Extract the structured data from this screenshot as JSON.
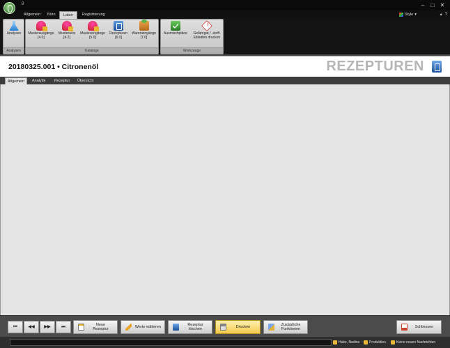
{
  "window": {
    "title": "8",
    "controls": {
      "minimize": "–",
      "maximize": "□",
      "close": "✕"
    }
  },
  "ribbon": {
    "tabs": [
      {
        "label": "Allgemein",
        "active": false
      },
      {
        "label": "Büro",
        "active": false
      },
      {
        "label": "Labor",
        "active": true
      },
      {
        "label": "Registrierung",
        "active": false
      }
    ],
    "style_label": "Style",
    "groups": {
      "analysen": {
        "caption": "Analysen",
        "buttons": [
          {
            "line1": "Analysen",
            "line2": "",
            "icon": "flask-icon"
          }
        ]
      },
      "kataloge": {
        "caption": "Kataloge",
        "buttons": [
          {
            "line1": "Musterausgänge",
            "line2": "[4.0]",
            "icon": "sample-out-icon"
          },
          {
            "line1": "Musteravis",
            "line2": "[4.2]",
            "icon": "sample-notice-icon"
          },
          {
            "line1": "Mustereingänge",
            "line2": "[5.0]",
            "icon": "sample-in-icon"
          },
          {
            "line1": "Rezepturen",
            "line2": "[6.0]",
            "icon": "recipe-book-icon"
          },
          {
            "line1": "Wareneingänge",
            "line2": "[7.0]",
            "icon": "goods-receipt-icon"
          }
        ]
      },
      "werkzeuge": {
        "caption": "Werkzeuge",
        "buttons": [
          {
            "line1": "Ausmischpläne",
            "line2": "",
            "icon": "mixing-plan-icon"
          },
          {
            "line1": "Gefahrgut / -stoff-",
            "line2": "Etiketten drucken",
            "icon": "hazard-label-icon"
          }
        ]
      }
    }
  },
  "header": {
    "record_title": "20180325.001 • Citronenöl",
    "section_title": "REZEPTUREN"
  },
  "content_tabs": [
    {
      "label": "Allgemein",
      "active": true
    },
    {
      "label": "Analytik",
      "active": false
    },
    {
      "label": "Rezeptur",
      "active": false
    },
    {
      "label": "Übersicht",
      "active": false
    }
  ],
  "toolbar": {
    "nav": {
      "first": "⏮",
      "prev": "◀◀",
      "next": "▶▶",
      "last": "⏭"
    },
    "new_label": "Neue\nRezeptur",
    "edit_label": "Werte editieren",
    "delete_label": "Rezeptur\nlöschen",
    "print_label": "Drucken",
    "more_label": "Zusätzliche\nFunktionen",
    "close_label": "Schliessen"
  },
  "statusbar": {
    "user": "Huke, Nadine",
    "module": "Produktion",
    "messages": "Keine neuen Nachrichten"
  },
  "colors": {
    "ribbon_dark": "#141414",
    "content_bg": "#e4e4e4",
    "highlight_button": "#f2c94c",
    "section_title": "#b6b6b6"
  }
}
